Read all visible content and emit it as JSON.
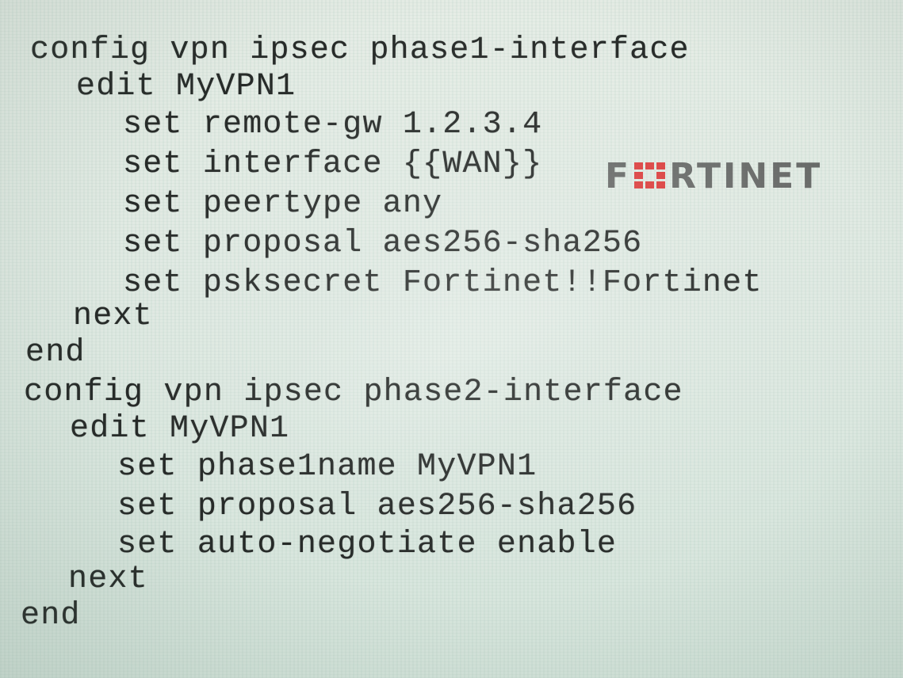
{
  "code_lines": [
    "config vpn ipsec phase1-interface",
    "edit MyVPN1",
    "set remote-gw 1.2.3.4",
    "set interface {{WAN}}",
    "set peertype any",
    "set proposal aes256-sha256",
    "set psksecret Fortinet!!Fortinet",
    "next",
    "end",
    "config vpn ipsec phase2-interface",
    "edit MyVPN1",
    "set phase1name MyVPN1",
    "set proposal aes256-sha256",
    "set auto-negotiate enable",
    "next",
    "end"
  ],
  "watermark": {
    "brand_prefix": "F",
    "brand_suffix": "RTINET",
    "brand_full": "FORTINET",
    "logo_color": "#da2828"
  },
  "colors": {
    "text": "#262a28",
    "background": "#dfe9e2"
  }
}
